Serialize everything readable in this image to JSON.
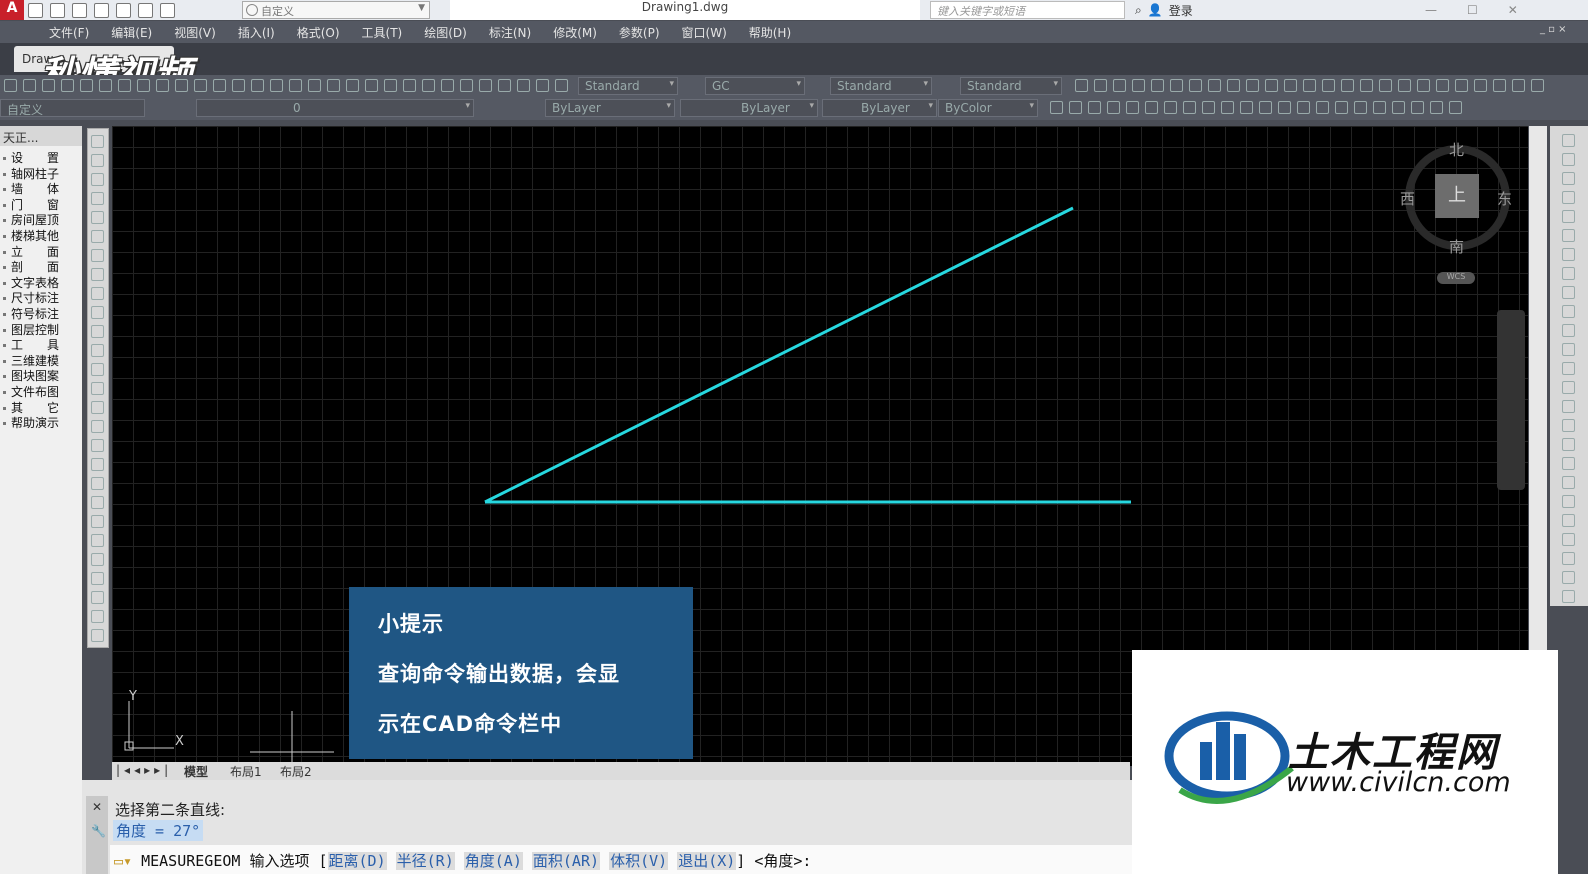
{
  "titlebar": {
    "workspace": "自定义",
    "document": "Drawing1.dwg",
    "search_placeholder": "键入关键字或短语",
    "login": "登录"
  },
  "menu": [
    "文件(F)",
    "编辑(E)",
    "视图(V)",
    "插入(I)",
    "格式(O)",
    "工具(T)",
    "绘图(D)",
    "标注(N)",
    "修改(M)",
    "参数(P)",
    "窗口(W)",
    "帮助(H)"
  ],
  "doc_tab": "Draw",
  "watermark": "秒懂视频",
  "toolbar1": {
    "text_style": "Standard",
    "dim_style": "GC",
    "table_style": "Standard",
    "mleader_style": "Standard"
  },
  "toolbar2": {
    "workspace": "自定义",
    "layer": "0",
    "color": "ByLayer",
    "linetype": "ByLayer",
    "lineweight": "ByLayer",
    "plotstyle": "ByColor"
  },
  "palette": {
    "title": "天正...",
    "items": [
      "设　　置",
      "轴网柱子",
      "墙　　体",
      "门　　窗",
      "房间屋顶",
      "楼梯其他",
      "立　　面",
      "剖　　面",
      "文字表格",
      "尺寸标注",
      "符号标注",
      "图层控制",
      "工　　具",
      "三维建模",
      "图块图案",
      "文件布图",
      "其　　它",
      "帮助演示"
    ]
  },
  "viewcube": {
    "north": "北",
    "south": "南",
    "east": "东",
    "west": "西",
    "face": "上",
    "wcs": "WCS"
  },
  "ucs": {
    "x": "X",
    "y": "Y"
  },
  "drawing": {
    "line_color": "#27d8e0"
  },
  "tip": {
    "title": "小提示",
    "line1": "查询命令输出数据，会显",
    "line2": "示在CAD命令栏中"
  },
  "layout_tabs": [
    "模型",
    "布局1",
    "布局2"
  ],
  "command": {
    "history1": "选择第二条直线:",
    "history2": "角度 = 27°",
    "prompt_cmd": "MEASUREGEOM 输入选项 [",
    "options": [
      "距离(D)",
      "半径(R)",
      "角度(A)",
      "面积(AR)",
      "体积(V)",
      "退出(X)"
    ],
    "prompt_end": "] <角度>:"
  },
  "brand": {
    "name": "土木工程网",
    "url": "www.civilcn.com",
    "colors": {
      "blue": "#1a5fa8",
      "green": "#3aa648"
    }
  }
}
